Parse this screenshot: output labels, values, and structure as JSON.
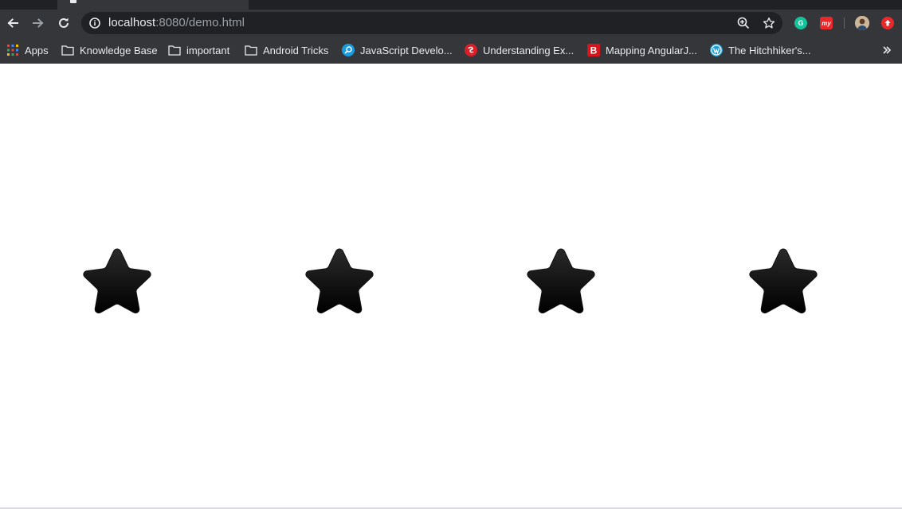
{
  "browser": {
    "url_host": "localhost",
    "url_rest": ":8080/demo.html"
  },
  "bookmarks": [
    {
      "label": "Apps",
      "icon": "apps-grid-icon"
    },
    {
      "label": "Knowledge Base",
      "icon": "folder-icon"
    },
    {
      "label": "important",
      "icon": "folder-icon"
    },
    {
      "label": "Android Tricks",
      "icon": "folder-icon"
    },
    {
      "label": "JavaScript Develo...",
      "icon": "javascript-site-icon"
    },
    {
      "label": "Understanding Ex...",
      "icon": "understanding-site-icon"
    },
    {
      "label": "Mapping AngularJ...",
      "icon": "b-site-icon"
    },
    {
      "label": "The Hitchhiker's...",
      "icon": "wordpress-icon"
    }
  ],
  "extensions": {
    "grammarly_letter": "G",
    "ext2_letter": "my",
    "ext_colors": {
      "grammarly": "#15c39a",
      "red": "#e8282b"
    }
  },
  "content": {
    "stars": [
      {
        "id": 1,
        "state": "filled",
        "color": "#111111"
      },
      {
        "id": 2,
        "state": "filled",
        "color": "#111111"
      },
      {
        "id": 3,
        "state": "filled",
        "color": "#111111"
      },
      {
        "id": 4,
        "state": "filled",
        "color": "#111111"
      }
    ]
  }
}
